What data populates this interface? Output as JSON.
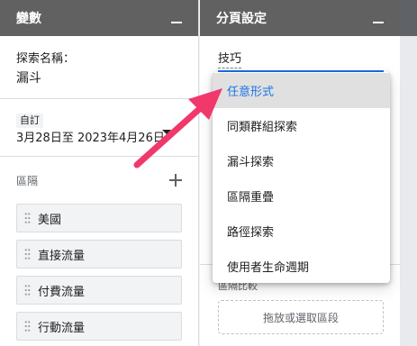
{
  "variables_panel": {
    "title": "變數",
    "exploration_name_label": "探索名稱：",
    "exploration_name_value": "漏斗",
    "date_range": {
      "chip": "自訂",
      "text": "3月28日至 2023年4月26日"
    },
    "segments": {
      "title": "區隔",
      "items": [
        "美國",
        "直接流量",
        "付費流量",
        "行動流量"
      ]
    }
  },
  "tab_settings_panel": {
    "title": "分頁設定",
    "technique_label": "技巧",
    "segment_comparison_label": "區隔比較",
    "dropzone_text": "拖放或選取區段"
  },
  "technique_menu": {
    "selected_index": 0,
    "options": [
      "任意形式",
      "同類群組探索",
      "漏斗探索",
      "區隔重疊",
      "路徑探索",
      "使用者生命週期"
    ]
  },
  "colors": {
    "header_bg": "#616161",
    "accent": "#1a73e8",
    "annotation_arrow": "#f0386b"
  }
}
